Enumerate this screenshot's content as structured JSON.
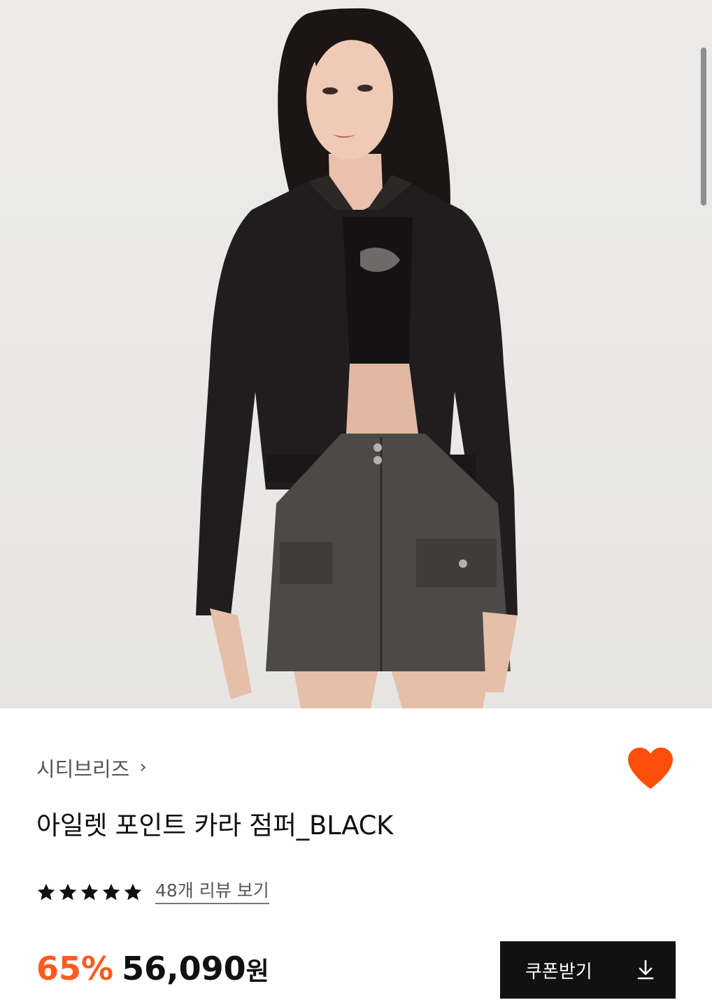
{
  "product": {
    "brand": "시티브리즈",
    "brand_chevron": "›",
    "name": "아일렛 포인트 카라 점퍼_BLACK",
    "rating_stars": 5,
    "review_link": "48개 리뷰 보기",
    "discount": "65%",
    "price": "56,090",
    "price_unit": "원",
    "coupon_button": "쿠폰받기"
  },
  "icons": {
    "wishlist": "heart-icon",
    "download": "download-icon",
    "star": "star-icon"
  },
  "colors": {
    "accent": "#ff5a1f",
    "button_bg": "#111111",
    "heart": "#ff4d0a"
  }
}
